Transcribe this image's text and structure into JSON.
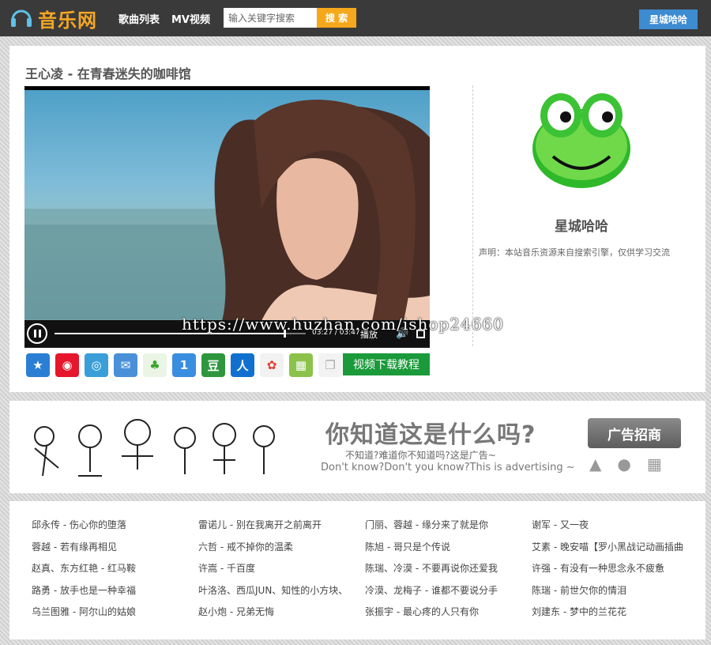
{
  "header": {
    "logo_text": "音乐网",
    "nav": [
      "歌曲列表",
      "MV视频"
    ],
    "search_placeholder": "输入关键字搜索",
    "search_button": "搜 索",
    "user_button": "星城哈哈"
  },
  "main": {
    "song_title": "王心凌 - 在青春迷失的咖啡馆",
    "player": {
      "time": "03:27 / 03:47",
      "play_label": "播放",
      "progress": 0.916
    },
    "watermark": "https://www.huzhan.com/ishop24660",
    "share_icons": [
      "qzone-icon",
      "weibo-icon",
      "tencent-weibo-icon",
      "email-icon",
      "kaixin-icon",
      "pengyou-icon",
      "douban-icon",
      "renren-icon",
      "feixin-icon",
      "baidu-icon",
      "copy-icon"
    ],
    "download_button": "视频下载教程"
  },
  "profile": {
    "name": "星城哈哈",
    "notice": "声明：本站音乐资源来自搜索引擎，仅供学习交流"
  },
  "ad": {
    "title": "你知道这是什么吗?",
    "sub1": "不知道?难道你不知道吗?这是广告~",
    "sub2": "Don't know?Don't you know?This is advertising ~",
    "button": "广告招商"
  },
  "songs": [
    "邱永传 - 伤心你的堕落",
    "雷诺儿 - 别在我离开之前离开",
    "门丽、蓉越 - 缘分来了就是你",
    "谢军 - 又一夜",
    "蓉越 - 若有缘再相见",
    "六哲 - 戒不掉你的温柔",
    "陈旭 - 哥只是个传说",
    "艾素 - 晚安喵【罗小黑战记动画插曲",
    "赵真、东方红艳 - 红马鞍",
    "许嵩 - 千百度",
    "陈瑞、冷漠 - 不要再说你还爱我",
    "许强 - 有没有一种思念永不疲惫",
    "路勇 - 放手也是一种幸福",
    "叶洛洛、西瓜JUN、知性的小方块、",
    "冷漠、龙梅子 - 谁都不要说分手",
    "陈瑞 - 前世欠你的情泪",
    "乌兰图雅 - 阿尔山的姑娘",
    "赵小炮 - 兄弟无悔",
    "张振宇 - 最心疼的人只有你",
    "刘建东 - 梦中的兰花花"
  ]
}
